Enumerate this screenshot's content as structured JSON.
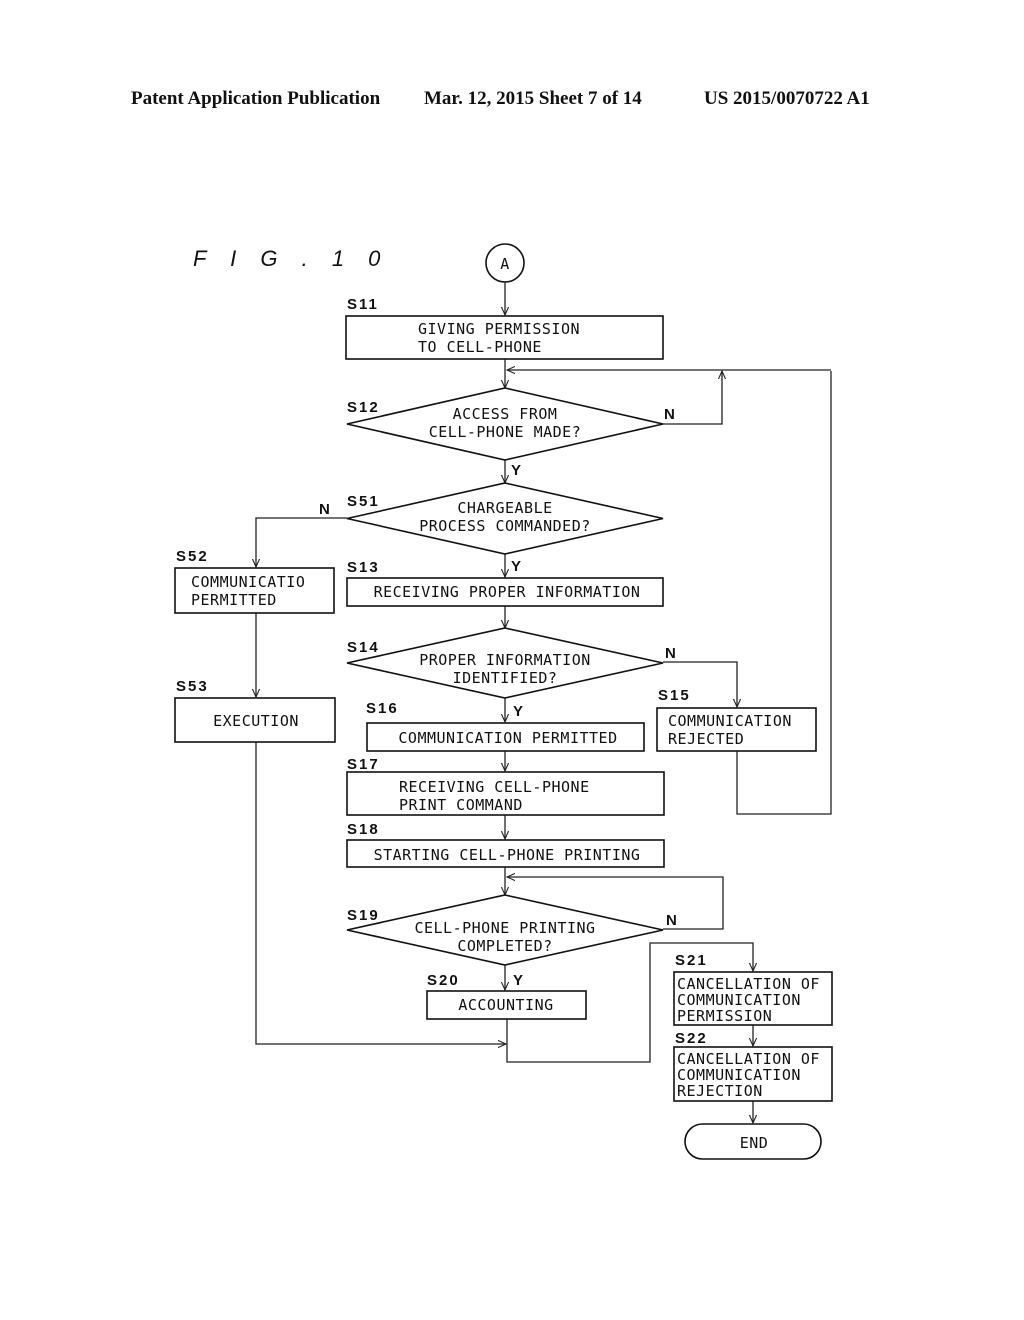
{
  "header": {
    "left": "Patent Application Publication",
    "middle": "Mar. 12, 2015  Sheet 7 of 14",
    "right": "US 2015/0070722 A1"
  },
  "figure": {
    "title": "F I G . 1 0",
    "connector": "A",
    "yes": "Y",
    "no": "N",
    "steps": {
      "S11": {
        "id": "S11",
        "type": "process",
        "lines": [
          "GIVING PERMISSION",
          "TO CELL-PHONE"
        ]
      },
      "S12": {
        "id": "S12",
        "type": "decision",
        "lines": [
          "ACCESS FROM",
          "CELL-PHONE MADE?"
        ]
      },
      "S51": {
        "id": "S51",
        "type": "decision",
        "lines": [
          "CHARGEABLE",
          "PROCESS COMMANDED?"
        ]
      },
      "S52": {
        "id": "S52",
        "type": "process",
        "lines": [
          "COMMUNICATIO",
          "PERMITTED"
        ]
      },
      "S53": {
        "id": "S53",
        "type": "process",
        "lines": [
          "EXECUTION"
        ]
      },
      "S13": {
        "id": "S13",
        "type": "process",
        "lines": [
          "RECEIVING PROPER INFORMATION"
        ]
      },
      "S14": {
        "id": "S14",
        "type": "decision",
        "lines": [
          "PROPER INFORMATION",
          "IDENTIFIED?"
        ]
      },
      "S15": {
        "id": "S15",
        "type": "process",
        "lines": [
          "COMMUNICATION",
          "REJECTED"
        ]
      },
      "S16": {
        "id": "S16",
        "type": "process",
        "lines": [
          "COMMUNICATION PERMITTED"
        ]
      },
      "S17": {
        "id": "S17",
        "type": "process",
        "lines": [
          "RECEIVING CELL-PHONE",
          "PRINT COMMAND"
        ]
      },
      "S18": {
        "id": "S18",
        "type": "process",
        "lines": [
          "STARTING CELL-PHONE PRINTING"
        ]
      },
      "S19": {
        "id": "S19",
        "type": "decision",
        "lines": [
          "CELL-PHONE PRINTING",
          "COMPLETED?"
        ]
      },
      "S20": {
        "id": "S20",
        "type": "process",
        "lines": [
          "ACCOUNTING"
        ]
      },
      "S21": {
        "id": "S21",
        "type": "process",
        "lines": [
          "CANCELLATION OF",
          "COMMUNICATION",
          "PERMISSION"
        ]
      },
      "S22": {
        "id": "S22",
        "type": "process",
        "lines": [
          "CANCELLATION OF",
          "COMMUNICATION",
          "REJECTION"
        ]
      }
    },
    "end": "END"
  }
}
